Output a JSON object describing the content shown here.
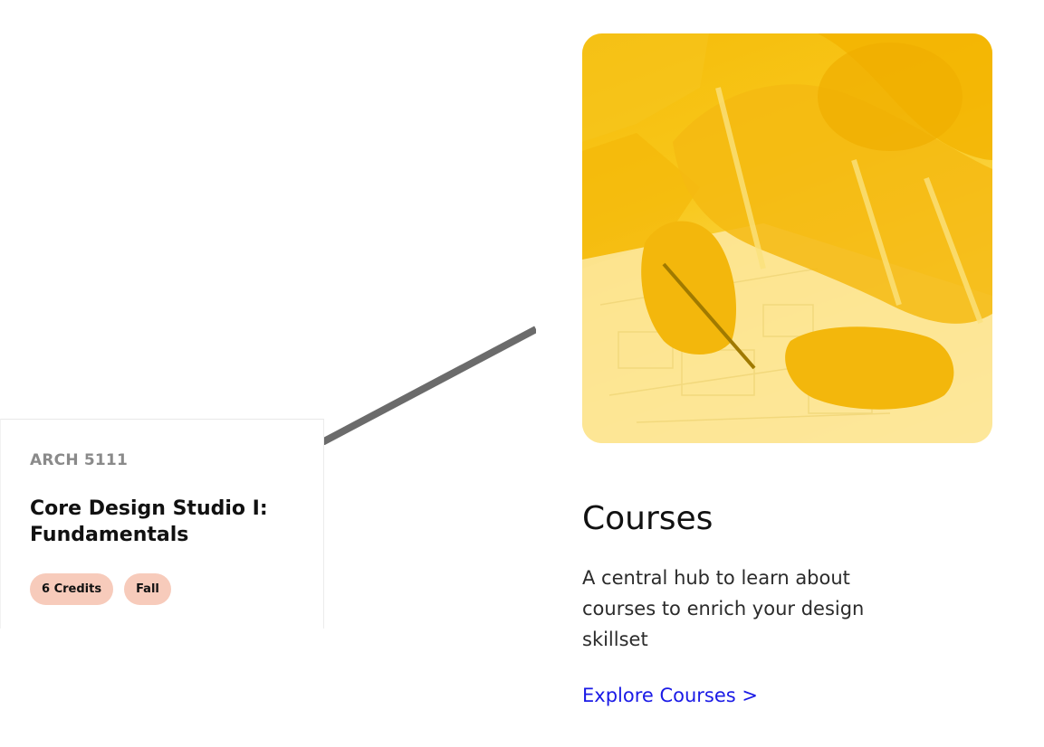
{
  "course_card": {
    "code": "ARCH 5111",
    "title": "Core Design Studio I: Fundamentals",
    "tags": [
      "6 Credits",
      "Fall"
    ],
    "tag_color": "#f7cbbb"
  },
  "feature": {
    "image_description_icon": "architecture-drafting-photo",
    "accent_color": "#f5bc0a",
    "title": "Courses",
    "description": "A central hub to learn about courses to enrich your design skillset",
    "link_label": "Explore Courses >",
    "link_color": "#1a1ae6"
  }
}
